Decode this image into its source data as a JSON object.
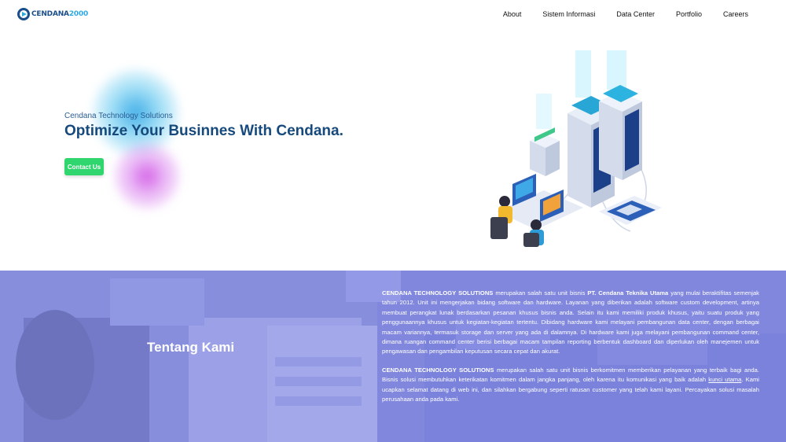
{
  "navbar": {
    "logo": {
      "brand": "CENDANA",
      "suffix": "2000"
    },
    "items": [
      {
        "label": "About"
      },
      {
        "label": "Sistem Informasi"
      },
      {
        "label": "Data Center"
      },
      {
        "label": "Portfolio"
      },
      {
        "label": "Careers"
      }
    ]
  },
  "hero": {
    "eyebrow": "Cendana Technology Solutions",
    "title": "Optimize Your Businnes With Cendana.",
    "cta_label": "Contact Us"
  },
  "about": {
    "title": "Tentang Kami",
    "p1": {
      "lead": "CENDANA TECHNOLOGY SOLUTIONS",
      "mid1": " merupakan salah satu unit bisnis ",
      "company": "PT. Cendana Teknika Utama",
      "rest": " yang mulai beraktifitas semenjak tahun 2012. Unit ini mengerjakan bidang software dan hardware. Layanan yang diberikan adalah software custom development, artinya membuat perangkat lunak berdasarkan pesanan khusus bisnis anda. Selain itu kami memiliki produk khusus, yaitu suatu produk yang penggunaannya khusus untuk kegiatan-kegiatan tertentu. Dibidang hardware kami melayani pembangunan data center, dengan berbagai macam variannya, termasuk storage dan server yang ada di dalamnya. Di hardware kami juga melayani pembangunan command center, dimana ruangan command center berisi berbagai macam tampilan reporting berbentuk dashboard dan diperlukan oleh manejemen untuk pengawasan dan pengambilan keputusan secara cepat dan akurat."
    },
    "p2": {
      "lead": "CENDANA TECHNOLOGY SOLUTIONS",
      "rest1": " merupakan salah satu unit bisnis berkomitmen memberikan pelayanan yang terbaik bagi anda. Bisnis solusi membutuhkan keterikatan komitmen dalam jangka panjang, oleh karena itu komunikasi yang baik adalah ",
      "link": "kunci utama",
      "rest2": ". Kami ucapkan selamat datang di web ini, dan silahkan bergabung seperti ratusan customer yang telah kami layani. Percayakan solusi masalah perusahaan anda pada kami."
    }
  },
  "colors": {
    "brand_dark": "#174a7c",
    "brand_light": "#2da9e1",
    "cta": "#2fd66d",
    "about_overlay": "#8088e0"
  },
  "icons": [
    "logo-mark-icon",
    "server-illustration"
  ]
}
